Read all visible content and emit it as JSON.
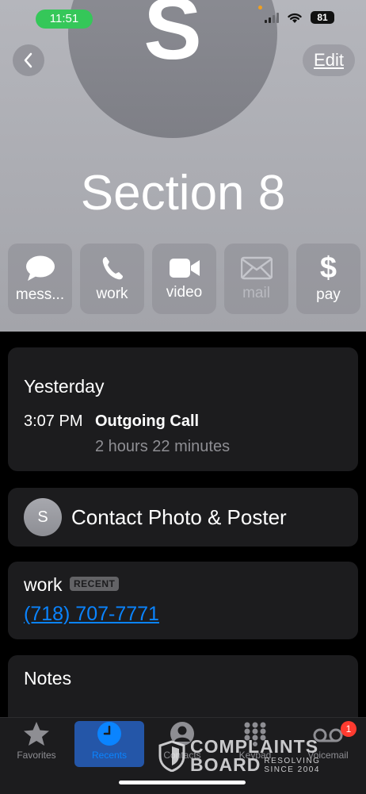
{
  "status_bar": {
    "time": "11:51",
    "battery": "81"
  },
  "header": {
    "avatar_initial": "S",
    "edit_label": "Edit",
    "contact_name": "Section 8"
  },
  "actions": [
    {
      "label": "mess...",
      "icon": "message-icon"
    },
    {
      "label": "work",
      "icon": "phone-icon"
    },
    {
      "label": "video",
      "icon": "video-icon"
    },
    {
      "label": "mail",
      "icon": "mail-icon",
      "disabled": true
    },
    {
      "label": "pay",
      "icon": "dollar-icon"
    }
  ],
  "call_history": {
    "date": "Yesterday",
    "time": "3:07 PM",
    "type": "Outgoing Call",
    "duration": "2 hours 22 minutes"
  },
  "contact_photo": {
    "initial": "S",
    "label": "Contact Photo & Poster"
  },
  "phone": {
    "label": "work",
    "badge": "RECENT",
    "number": "(718) 707-7771"
  },
  "notes": {
    "label": "Notes"
  },
  "tabbar": {
    "tabs": [
      {
        "label": "Favorites",
        "icon": "star-icon"
      },
      {
        "label": "Recents",
        "icon": "clock-icon",
        "active": true
      },
      {
        "label": "Contacts",
        "icon": "person-icon"
      },
      {
        "label": "Keypad",
        "icon": "keypad-icon"
      },
      {
        "label": "Voicemail",
        "icon": "voicemail-icon",
        "badge": "1"
      }
    ]
  },
  "watermark": {
    "line1": "COMPLAINTS",
    "line2": "BOARD",
    "tag1": "RESOLVING",
    "tag2": "SINCE 2004"
  },
  "colors": {
    "accent": "#0a84ff",
    "status_green": "#35c759",
    "badge_red": "#ff3b30"
  }
}
